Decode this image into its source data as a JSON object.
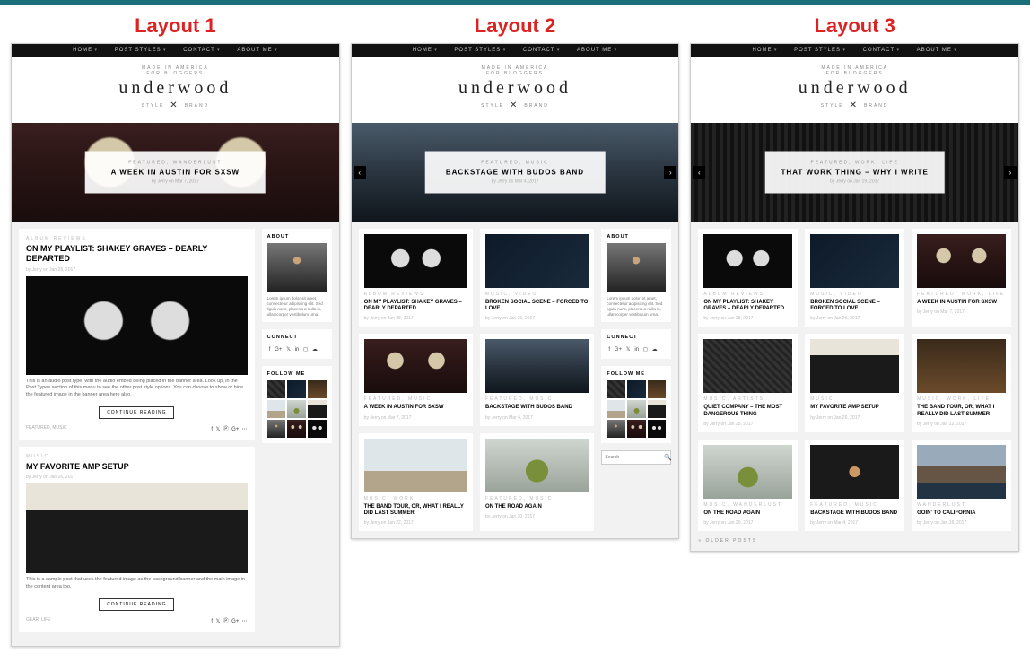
{
  "labels": {
    "layout1": "Layout 1",
    "layout2": "Layout 2",
    "layout3": "Layout 3"
  },
  "nav": {
    "items": [
      "HOME",
      "POST STYLES",
      "CONTACT",
      "ABOUT ME"
    ]
  },
  "brand": {
    "tagline_top": "MADE IN AMERICA",
    "tagline_sub": "FOR BLOGGERS",
    "name": "underwood",
    "sub_left": "STYLE",
    "sub_right": "BRAND"
  },
  "widgets": {
    "about": {
      "title": "ABOUT",
      "text": "Lorem ipsum dolor sit amet, consectetur adipiscing elit. Sed ligula nunc, placerat a nulla in, ullamcorper vestibulum urna."
    },
    "connect": {
      "title": "CONNECT"
    },
    "follow": {
      "title": "FOLLOW ME"
    },
    "search": {
      "placeholder": "Search"
    }
  },
  "buttons": {
    "continue": "CONTINUE READING"
  },
  "older": "« OLDER POSTS",
  "layout1": {
    "hero": {
      "cat": "FEATURED, WANDERLUST",
      "title": "A WEEK IN AUSTIN FOR SXSW",
      "meta": "by Jerry on Mar 7, 2017"
    },
    "posts": [
      {
        "cat": "ALBUM REVIEWS",
        "title": "ON MY PLAYLIST: SHAKEY GRAVES – DEARLY DEPARTED",
        "meta": "by Jerry on Jan 28, 2017",
        "excerpt": "This is an audio post type, with the audio embed being placed in the banner area. Look up, in the Post Types section of this menu to see the other post style options. You can choose to show or hide the featured image in the banner area here also.",
        "tags": "FEATURED, MUSIC"
      },
      {
        "cat": "MUSIC",
        "title": "MY FAVORITE AMP SETUP",
        "meta": "by Jerry on Jan 26, 2017",
        "excerpt": "This is a sample post that uses the featured image as the background banner and the main image in the content area too.",
        "tags": "GEAR, LIFE"
      }
    ]
  },
  "layout2": {
    "hero": {
      "cat": "FEATURED, MUSIC",
      "title": "BACKSTAGE WITH BUDOS BAND",
      "meta": "by Jerry on Mar 4, 2017"
    },
    "posts": [
      {
        "cat": "ALBUM REVIEWS",
        "title": "ON MY PLAYLIST: SHAKEY GRAVES – DEARLY DEPARTED",
        "meta": "by Jerry on Jan 28, 2017"
      },
      {
        "cat": "MUSIC, VIDEO",
        "title": "BROKEN SOCIAL SCENE – FORCED TO LOVE",
        "meta": "by Jerry on Jan 26, 2017"
      },
      {
        "cat": "FEATURED, MUSIC",
        "title": "A WEEK IN AUSTIN FOR SXSW",
        "meta": "by Jerry on Mar 7, 2017"
      },
      {
        "cat": "FEATURED, MUSIC",
        "title": "BACKSTAGE WITH BUDOS BAND",
        "meta": "by Jerry on Mar 4, 2017"
      },
      {
        "cat": "MUSIC, WORK",
        "title": "THE BAND TOUR, OR, WHAT I REALLY DID LAST SUMMER",
        "meta": "by Jerry on Jan 22, 2017"
      },
      {
        "cat": "FEATURED, MUSIC",
        "title": "ON THE ROAD AGAIN",
        "meta": "by Jerry on Jan 20, 2017"
      }
    ]
  },
  "layout3": {
    "hero": {
      "cat": "FEATURED, WORK, LIFE",
      "title": "THAT WORK THING – WHY I WRITE",
      "meta": "by Jerry on Jan 29, 2017"
    },
    "posts": [
      {
        "cat": "ALBUM REVIEWS",
        "title": "ON MY PLAYLIST: SHAKEY GRAVES – DEARLY DEPARTED",
        "meta": "by Jerry on Jan 28, 2017"
      },
      {
        "cat": "MUSIC, VIDEO",
        "title": "BROKEN SOCIAL SCENE – FORCED TO LOVE",
        "meta": "by Jerry on Jan 26, 2017"
      },
      {
        "cat": "FEATURED, WORK, LIFE",
        "title": "A WEEK IN AUSTIN FOR SXSW",
        "meta": "by Jerry on Mar 7, 2017"
      },
      {
        "cat": "MUSIC, ARTISTS",
        "title": "QUIET COMPANY – THE MOST DANGEROUS THING",
        "meta": "by Jerry on Jan 25, 2017"
      },
      {
        "cat": "MUSIC",
        "title": "MY FAVORITE AMP SETUP",
        "meta": "by Jerry on Jan 26, 2017"
      },
      {
        "cat": "MUSIC, WORK, LIFE",
        "title": "THE BAND TOUR, OR, WHAT I REALLY DID LAST SUMMER",
        "meta": "by Jerry on Jan 22, 2017"
      },
      {
        "cat": "MUSIC, WANDERLUST",
        "title": "ON THE ROAD AGAIN",
        "meta": "by Jerry on Jan 20, 2017"
      },
      {
        "cat": "FEATURED, MUSIC",
        "title": "BACKSTAGE WITH BUDOS BAND",
        "meta": "by Jerry on Mar 4, 2017"
      },
      {
        "cat": "WANDERLUST",
        "title": "GOIN' TO CALIFORNIA",
        "meta": "by Jerry on Jan 18, 2017"
      }
    ]
  }
}
